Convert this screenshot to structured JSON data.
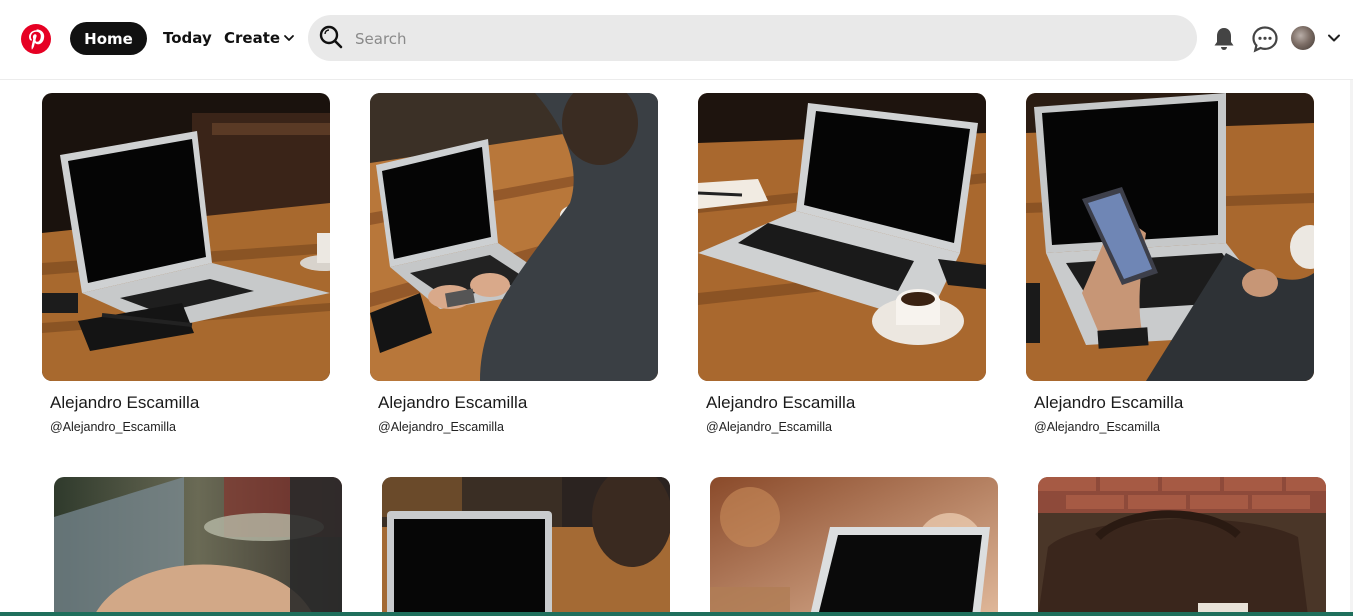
{
  "header": {
    "logo_icon": "pinterest-logo-icon",
    "brand_color": "#e60023",
    "nav": {
      "home_label": "Home",
      "today_label": "Today",
      "create_label": "Create"
    },
    "search": {
      "placeholder": "Search",
      "value": ""
    },
    "icons": [
      "bell-icon",
      "chat-bubble-icon",
      "avatar",
      "chevron-down-icon"
    ]
  },
  "pins": [
    {
      "name": "Alejandro Escamilla",
      "handle": "@Alejandro_Escamilla",
      "scene": "laptop-on-wooden-table"
    },
    {
      "name": "Alejandro Escamilla",
      "handle": "@Alejandro_Escamilla",
      "scene": "person-typing-on-laptop"
    },
    {
      "name": "Alejandro Escamilla",
      "handle": "@Alejandro_Escamilla",
      "scene": "laptop-with-coffee-cup"
    },
    {
      "name": "Alejandro Escamilla",
      "handle": "@Alejandro_Escamilla",
      "scene": "hand-holding-phone-at-laptop"
    },
    {
      "scene": "blurred-hands-on-laptop"
    },
    {
      "scene": "laptop-screen-person-behind"
    },
    {
      "scene": "laptop-warm-bokeh"
    },
    {
      "scene": "leather-bag-brick-wall"
    }
  ]
}
